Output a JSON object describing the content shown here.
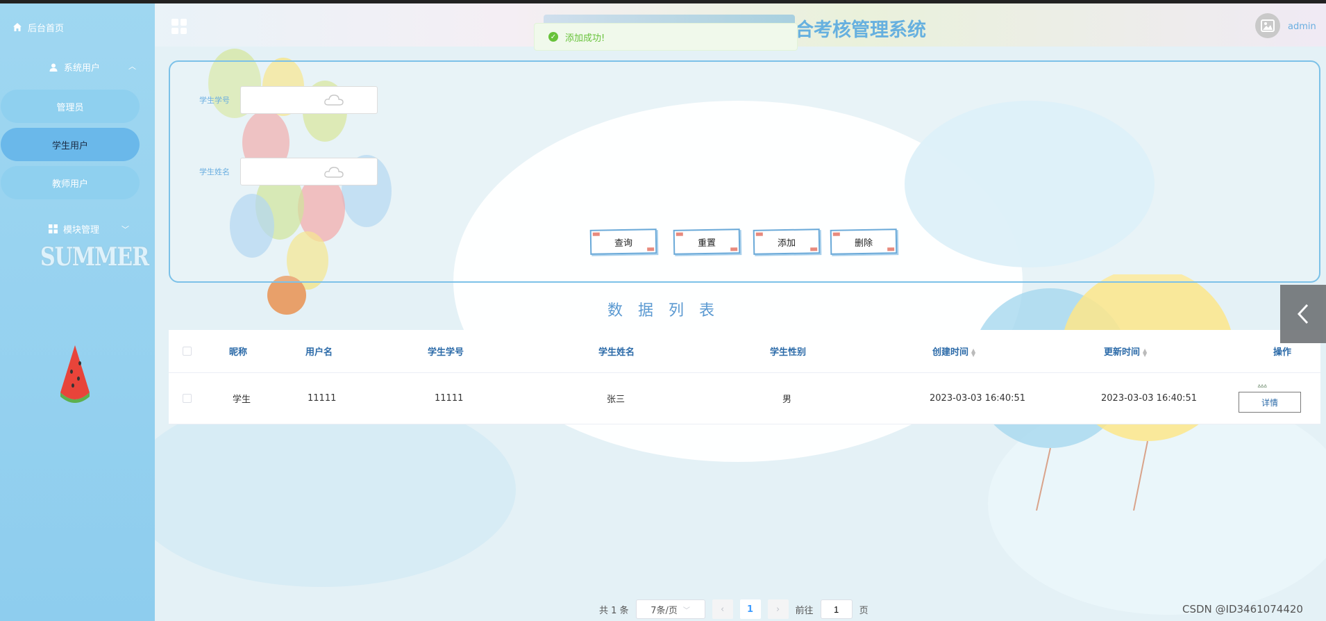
{
  "header": {
    "title": "合考核管理系统",
    "username": "admin"
  },
  "toast": {
    "message": "添加成功!"
  },
  "sidebar": {
    "home_label": "后台首页",
    "group_label": "系统用户",
    "items": [
      {
        "label": "管理员"
      },
      {
        "label": "学生用户"
      },
      {
        "label": "教师用户"
      }
    ],
    "module_label": "模块管理",
    "decor_text": "SUMMER"
  },
  "search": {
    "student_no_label": "学生学号",
    "student_name_label": "学生姓名",
    "buttons": {
      "query": "查询",
      "reset": "重置",
      "add": "添加",
      "delete": "删除"
    }
  },
  "list": {
    "title": "数据列表",
    "columns": [
      "昵称",
      "用户名",
      "学生学号",
      "学生姓名",
      "学生性别",
      "创建时间",
      "更新时间",
      "操作"
    ],
    "rows": [
      {
        "nickname": "学生",
        "username": "11111",
        "student_no": "11111",
        "student_name": "张三",
        "gender": "男",
        "created": "2023-03-03 16:40:51",
        "updated": "2023-03-03 16:40:51",
        "action": "详情"
      }
    ]
  },
  "pagination": {
    "total": "共 1 条",
    "page_size": "7条/页",
    "current_page": "1",
    "goto_prefix": "前往",
    "goto_value": "1",
    "goto_suffix": "页"
  },
  "watermark": "CSDN @ID3461074420",
  "colors": {
    "sidebar": "#8ecdee",
    "accent": "#6aaee0",
    "toast_success": "#67c23a"
  }
}
